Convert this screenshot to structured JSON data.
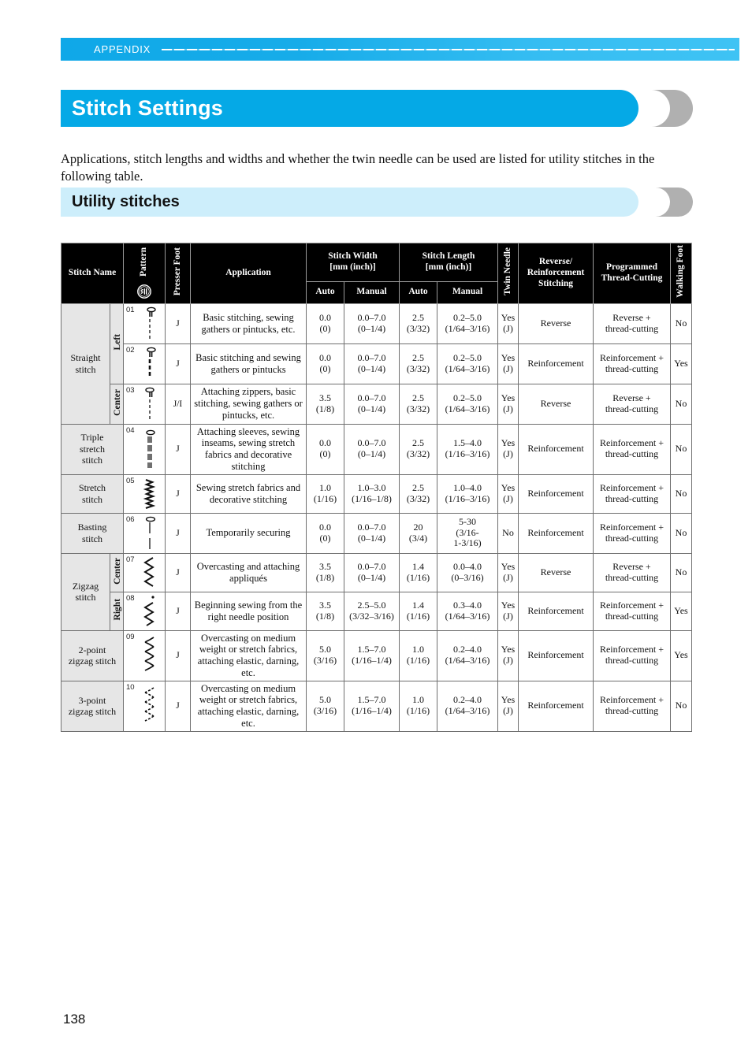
{
  "running_header": {
    "label": "APPENDIX"
  },
  "section": {
    "title": "Stitch Settings",
    "intro": "Applications, stitch lengths and widths and whether the twin needle can be used are listed for utility stitches in the following table.",
    "subtitle": "Utility stitches"
  },
  "page_number": "138",
  "colors": {
    "accent_blue": "#05a9e6",
    "appendix_bar": "#17ace9",
    "subtitle_blue": "#cdeefb",
    "crescent_gray": "#b0b0b0",
    "header_black": "#000000",
    "name_cell_gray": "#e6e6e6"
  },
  "table": {
    "headers": {
      "stitch_name": "Stitch Name",
      "pattern": "Pattern",
      "pattern_icon": "stitch-pattern-dial-icon",
      "presser_foot": "Presser Foot",
      "application": "Application",
      "stitch_width": "Stitch Width",
      "stitch_width_unit": "[mm (inch)]",
      "stitch_length": "Stitch Length",
      "stitch_length_unit": "[mm (inch)]",
      "auto": "Auto",
      "manual": "Manual",
      "twin_needle": "Twin Needle",
      "reverse_reinforcement": "Reverse/\nReinforcement\nStitching",
      "reverse_reinforcement_l1": "Reverse/",
      "reverse_reinforcement_l2": "Reinforcement",
      "reverse_reinforcement_l3": "Stitching",
      "programmed_thread_cutting_l1": "Programmed",
      "programmed_thread_cutting_l2": "Thread-Cutting",
      "walking_foot": "Walking Foot"
    },
    "groups": [
      {
        "name": "Straight\nstitch",
        "name_l1": "Straight",
        "name_l2": "stitch",
        "rowspan": 3
      },
      {
        "name": "Triple\nstretch\nstitch",
        "name_l1": "Triple",
        "name_l2": "stretch",
        "name_l3": "stitch",
        "rowspan": 1
      },
      {
        "name": "Stretch\nstitch",
        "name_l1": "Stretch",
        "name_l2": "stitch",
        "rowspan": 1
      },
      {
        "name": "Basting\nstitch",
        "name_l1": "Basting",
        "name_l2": "stitch",
        "rowspan": 1
      },
      {
        "name": "Zigzag\nstitch",
        "name_l1": "Zigzag",
        "name_l2": "stitch",
        "rowspan": 2
      },
      {
        "name": "2-point\nzigzag stitch",
        "name_l1": "2-point",
        "name_l2": "zigzag stitch",
        "rowspan": 1
      },
      {
        "name": "3-point\nzigzag stitch",
        "name_l1": "3-point",
        "name_l2": "zigzag stitch",
        "rowspan": 1
      }
    ],
    "rows": [
      {
        "index": "01",
        "position": "Left",
        "position_rowspan": 2,
        "pattern_icon": "straight-stitch-left-icon",
        "presser_foot": "J",
        "application": "Basic stitching, sewing gathers or pintucks, etc.",
        "width_auto": "0.0",
        "width_auto_in": "(0)",
        "width_manual": "0.0–7.0",
        "width_manual_in": "(0–1/4)",
        "length_auto": "2.5",
        "length_auto_in": "(3/32)",
        "length_manual": "0.2–5.0",
        "length_manual_in": "(1/64–3/16)",
        "twin_needle": "Yes",
        "twin_needle_sub": "(J)",
        "reverse_reinforcement": "Reverse",
        "thread_cutting_l1": "Reverse +",
        "thread_cutting_l2": "thread-cutting",
        "walking_foot": "No"
      },
      {
        "index": "02",
        "pattern_icon": "straight-stitch-left-bold-icon",
        "presser_foot": "J",
        "application": "Basic stitching and sewing gathers or pintucks",
        "width_auto": "0.0",
        "width_auto_in": "(0)",
        "width_manual": "0.0–7.0",
        "width_manual_in": "(0–1/4)",
        "length_auto": "2.5",
        "length_auto_in": "(3/32)",
        "length_manual": "0.2–5.0",
        "length_manual_in": "(1/64–3/16)",
        "twin_needle": "Yes",
        "twin_needle_sub": "(J)",
        "reverse_reinforcement": "Reinforcement",
        "thread_cutting_l1": "Reinforcement +",
        "thread_cutting_l2": "thread-cutting",
        "walking_foot": "Yes"
      },
      {
        "index": "03",
        "position": "Center",
        "position_rowspan": 1,
        "pattern_icon": "straight-stitch-center-icon",
        "presser_foot": "J/I",
        "application": "Attaching zippers, basic stitching, sewing gathers or pintucks, etc.",
        "width_auto": "3.5",
        "width_auto_in": "(1/8)",
        "width_manual": "0.0–7.0",
        "width_manual_in": "(0–1/4)",
        "length_auto": "2.5",
        "length_auto_in": "(3/32)",
        "length_manual": "0.2–5.0",
        "length_manual_in": "(1/64–3/16)",
        "twin_needle": "Yes",
        "twin_needle_sub": "(J)",
        "reverse_reinforcement": "Reverse",
        "thread_cutting_l1": "Reverse +",
        "thread_cutting_l2": "thread-cutting",
        "walking_foot": "No"
      },
      {
        "index": "04",
        "pattern_icon": "triple-stretch-stitch-icon",
        "presser_foot": "J",
        "application": "Attaching sleeves, sewing inseams, sewing stretch fabrics and decorative stitching",
        "width_auto": "0.0",
        "width_auto_in": "(0)",
        "width_manual": "0.0–7.0",
        "width_manual_in": "(0–1/4)",
        "length_auto": "2.5",
        "length_auto_in": "(3/32)",
        "length_manual": "1.5–4.0",
        "length_manual_in": "(1/16–3/16)",
        "twin_needle": "Yes",
        "twin_needle_sub": "(J)",
        "reverse_reinforcement": "Reinforcement",
        "thread_cutting_l1": "Reinforcement +",
        "thread_cutting_l2": "thread-cutting",
        "walking_foot": "No"
      },
      {
        "index": "05",
        "pattern_icon": "stretch-stitch-icon",
        "presser_foot": "J",
        "application": "Sewing stretch fabrics and decorative stitching",
        "width_auto": "1.0",
        "width_auto_in": "(1/16)",
        "width_manual": "1.0–3.0",
        "width_manual_in": "(1/16–1/8)",
        "length_auto": "2.5",
        "length_auto_in": "(3/32)",
        "length_manual": "1.0–4.0",
        "length_manual_in": "(1/16–3/16)",
        "twin_needle": "Yes",
        "twin_needle_sub": "(J)",
        "reverse_reinforcement": "Reinforcement",
        "thread_cutting_l1": "Reinforcement +",
        "thread_cutting_l2": "thread-cutting",
        "walking_foot": "No"
      },
      {
        "index": "06",
        "pattern_icon": "basting-stitch-icon",
        "presser_foot": "J",
        "application": "Temporarily securing",
        "width_auto": "0.0",
        "width_auto_in": "(0)",
        "width_manual": "0.0–7.0",
        "width_manual_in": "(0–1/4)",
        "length_auto": "20",
        "length_auto_in": "(3/4)",
        "length_manual": "5-30",
        "length_manual_in": "(3/16-",
        "length_manual_in2": "1-3/16)",
        "twin_needle": "No",
        "twin_needle_sub": "",
        "reverse_reinforcement": "Reinforcement",
        "thread_cutting_l1": "Reinforcement +",
        "thread_cutting_l2": "thread-cutting",
        "walking_foot": "No"
      },
      {
        "index": "07",
        "position": "Center",
        "position_rowspan": 1,
        "pattern_icon": "zigzag-stitch-center-icon",
        "presser_foot": "J",
        "application": "Overcasting and attaching appliqués",
        "width_auto": "3.5",
        "width_auto_in": "(1/8)",
        "width_manual": "0.0–7.0",
        "width_manual_in": "(0–1/4)",
        "length_auto": "1.4",
        "length_auto_in": "(1/16)",
        "length_manual": "0.0–4.0",
        "length_manual_in": "(0–3/16)",
        "twin_needle": "Yes",
        "twin_needle_sub": "(J)",
        "reverse_reinforcement": "Reverse",
        "thread_cutting_l1": "Reverse +",
        "thread_cutting_l2": "thread-cutting",
        "walking_foot": "No"
      },
      {
        "index": "08",
        "position": "Right",
        "position_rowspan": 1,
        "pattern_icon": "zigzag-stitch-right-icon",
        "presser_foot": "J",
        "application": "Beginning sewing from the right needle position",
        "width_auto": "3.5",
        "width_auto_in": "(1/8)",
        "width_manual": "2.5–5.0",
        "width_manual_in": "(3/32–3/16)",
        "length_auto": "1.4",
        "length_auto_in": "(1/16)",
        "length_manual": "0.3–4.0",
        "length_manual_in": "(1/64–3/16)",
        "twin_needle": "Yes",
        "twin_needle_sub": "(J)",
        "reverse_reinforcement": "Reinforcement",
        "thread_cutting_l1": "Reinforcement +",
        "thread_cutting_l2": "thread-cutting",
        "walking_foot": "Yes"
      },
      {
        "index": "09",
        "pattern_icon": "two-point-zigzag-stitch-icon",
        "presser_foot": "J",
        "application": "Overcasting on medium weight or stretch fabrics, attaching elastic, darning, etc.",
        "width_auto": "5.0",
        "width_auto_in": "(3/16)",
        "width_manual": "1.5–7.0",
        "width_manual_in": "(1/16–1/4)",
        "length_auto": "1.0",
        "length_auto_in": "(1/16)",
        "length_manual": "0.2–4.0",
        "length_manual_in": "(1/64–3/16)",
        "twin_needle": "Yes",
        "twin_needle_sub": "(J)",
        "reverse_reinforcement": "Reinforcement",
        "thread_cutting_l1": "Reinforcement +",
        "thread_cutting_l2": "thread-cutting",
        "walking_foot": "Yes"
      },
      {
        "index": "10",
        "pattern_icon": "three-point-zigzag-stitch-icon",
        "presser_foot": "J",
        "application": "Overcasting on medium weight or stretch fabrics, attaching elastic, darning, etc.",
        "width_auto": "5.0",
        "width_auto_in": "(3/16)",
        "width_manual": "1.5–7.0",
        "width_manual_in": "(1/16–1/4)",
        "length_auto": "1.0",
        "length_auto_in": "(1/16)",
        "length_manual": "0.2–4.0",
        "length_manual_in": "(1/64–3/16)",
        "twin_needle": "Yes",
        "twin_needle_sub": "(J)",
        "reverse_reinforcement": "Reinforcement",
        "thread_cutting_l1": "Reinforcement +",
        "thread_cutting_l2": "thread-cutting",
        "walking_foot": "No"
      }
    ]
  }
}
